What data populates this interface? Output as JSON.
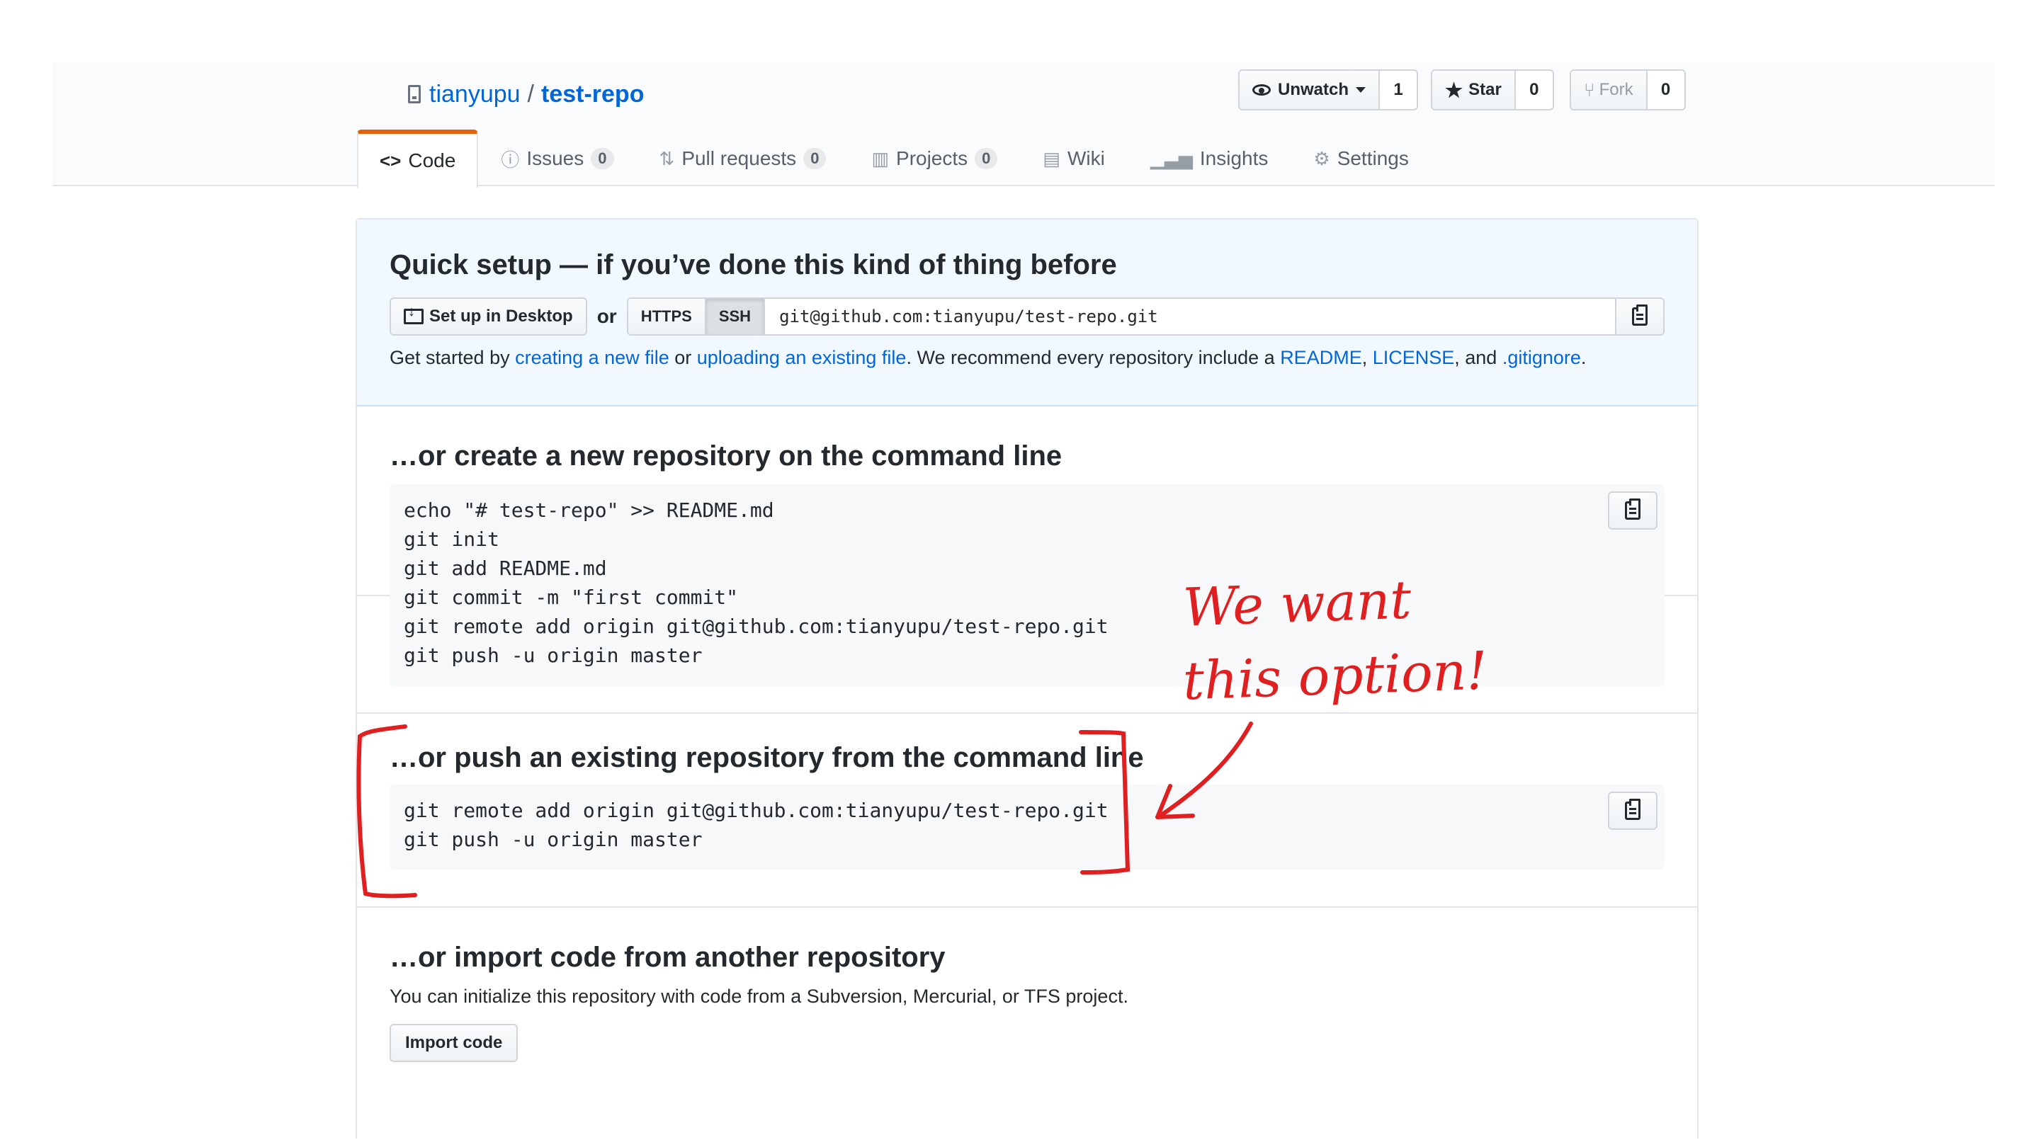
{
  "repo": {
    "owner": "tianyupu",
    "separator": "/",
    "name": "test-repo"
  },
  "actions": {
    "watch": {
      "label": "Unwatch",
      "count": "1",
      "icon": "eye-icon"
    },
    "star": {
      "label": "Star",
      "count": "0",
      "icon": "star-icon"
    },
    "fork": {
      "label": "Fork",
      "count": "0",
      "icon": "fork-icon"
    }
  },
  "tabs": [
    {
      "label": "Code",
      "icon": "code-icon",
      "selected": true
    },
    {
      "label": "Issues",
      "count": "0",
      "icon": "issue-icon"
    },
    {
      "label": "Pull requests",
      "count": "0",
      "icon": "pull-request-icon"
    },
    {
      "label": "Projects",
      "count": "0",
      "icon": "project-icon"
    },
    {
      "label": "Wiki",
      "icon": "book-icon"
    },
    {
      "label": "Insights",
      "icon": "graph-icon"
    },
    {
      "label": "Settings",
      "icon": "gear-icon"
    }
  ],
  "quick_setup": {
    "title": "Quick setup — if you’ve done this kind of thing before",
    "desktop_button": "Set up in Desktop",
    "or": "or",
    "https": "HTTPS",
    "ssh": "SSH",
    "url": "git@github.com:tianyupu/test-repo.git",
    "help": {
      "p1": "Get started by ",
      "link1": "creating a new file",
      "p2": " or ",
      "link2": "uploading an existing file",
      "p3": ". We recommend every repository include a ",
      "link3": "README",
      "p4": ", ",
      "link4": "LICENSE",
      "p5": ", and ",
      "link5": ".gitignore",
      "p6": "."
    }
  },
  "create_section": {
    "title": "…or create a new repository on the command line",
    "code": "echo \"# test-repo\" >> README.md\ngit init\ngit add README.md\ngit commit -m \"first commit\"\ngit remote add origin git@github.com:tianyupu/test-repo.git\ngit push -u origin master"
  },
  "push_section": {
    "title": "…or push an existing repository from the command line",
    "code": "git remote add origin git@github.com:tianyupu/test-repo.git\ngit push -u origin master"
  },
  "import_section": {
    "title": "…or import code from another repository",
    "subtitle": "You can initialize this repository with code from a Subversion, Mercurial, or TFS project.",
    "button": "Import code"
  },
  "annotation": {
    "line1": "We want",
    "line2": "this option!",
    "color": "#e02020"
  }
}
